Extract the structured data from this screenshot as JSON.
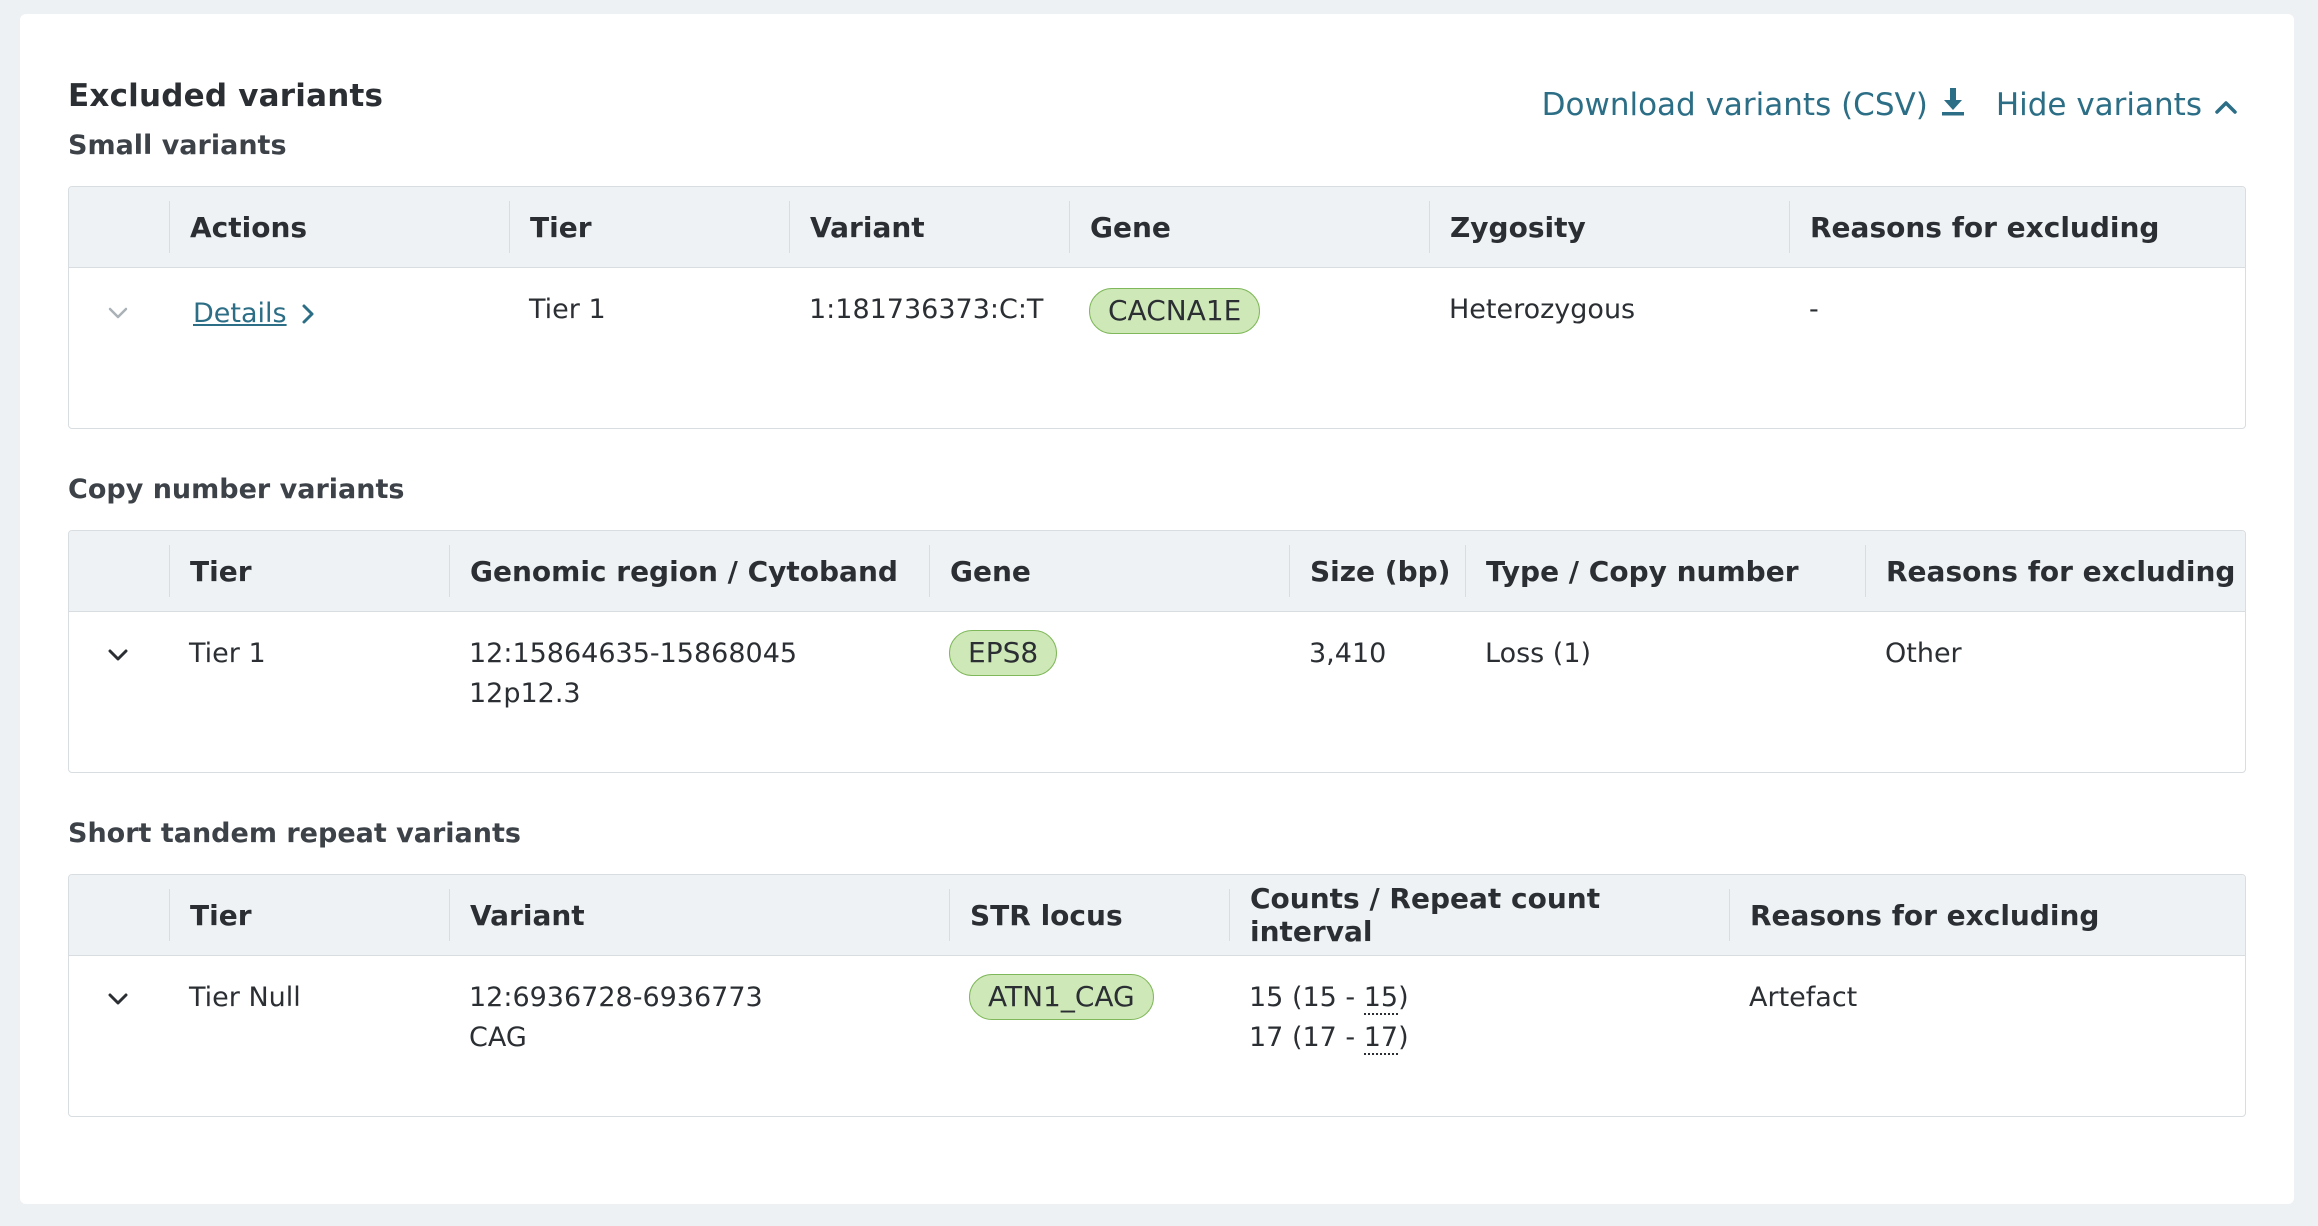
{
  "header": {
    "title": "Excluded variants",
    "download_label": "Download variants (CSV)",
    "hide_label": "Hide variants"
  },
  "small_variants": {
    "title": "Small variants",
    "columns": [
      "",
      "Actions",
      "Tier",
      "Variant",
      "Gene",
      "Zygosity",
      "Reasons for excluding"
    ],
    "rows": [
      {
        "action": "Details",
        "tier": "Tier 1",
        "variant": "1:181736373:C:T",
        "gene": "CACNA1E",
        "zygosity": "Heterozygous",
        "reason": "-"
      }
    ]
  },
  "copy_number_variants": {
    "title": "Copy number variants",
    "columns": [
      "",
      "Tier",
      "Genomic region / Cytoband",
      "Gene",
      "Size (bp)",
      "Type / Copy number",
      "Reasons for excluding"
    ],
    "rows": [
      {
        "tier": "Tier 1",
        "region": "12:15864635-15868045",
        "cytoband": "12p12.3",
        "gene": "EPS8",
        "size": "3,410",
        "type": "Loss (1)",
        "reason": "Other"
      }
    ]
  },
  "str_variants": {
    "title": "Short tandem repeat variants",
    "columns": [
      "",
      "Tier",
      "Variant",
      "STR locus",
      "Counts / Repeat count interval",
      "Reasons for excluding"
    ],
    "rows": [
      {
        "tier": "Tier Null",
        "variant": "12:6936728-6936773",
        "repeat": "CAG",
        "locus": "ATN1_CAG",
        "count1_prefix": "15 (15 - ",
        "count1_value": "15",
        "count2_prefix": "17 (17 - ",
        "count2_value": "17",
        "reason": "Artefact"
      }
    ]
  },
  "colors": {
    "link": "#2c6e86",
    "pill_bg": "#cfe8b8",
    "pill_border": "#7fb85a",
    "header_bg": "#eff2f4"
  }
}
